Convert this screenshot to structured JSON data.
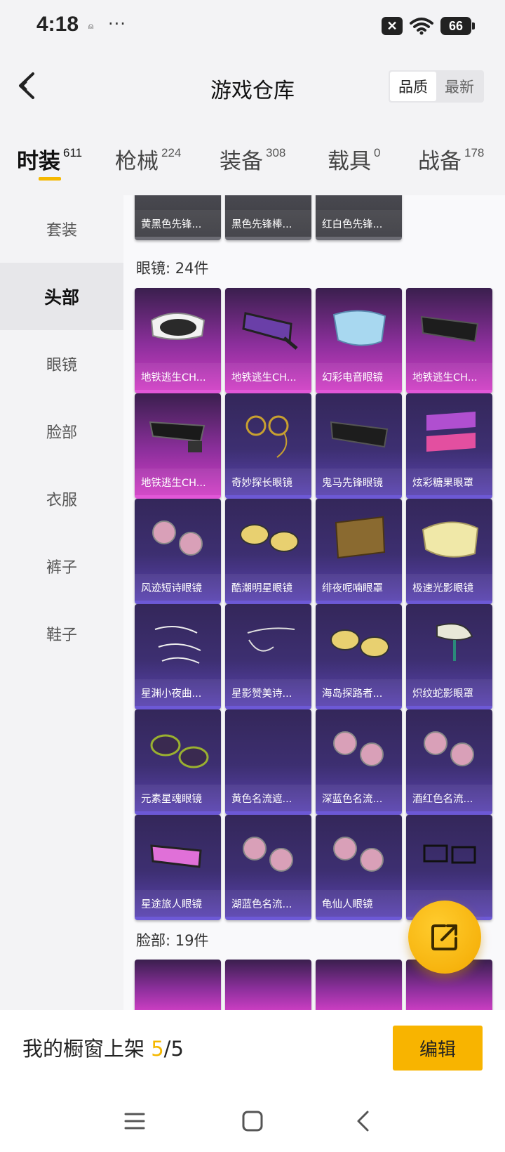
{
  "status_bar": {
    "time": "4:18",
    "small_icon": "⍝",
    "dots": "···",
    "battery": "66"
  },
  "header": {
    "title": "游戏仓库",
    "sort_options": [
      "品质",
      "最新"
    ]
  },
  "tabs": [
    {
      "label": "时装",
      "count": "611"
    },
    {
      "label": "枪械",
      "count": "224"
    },
    {
      "label": "装备",
      "count": "308"
    },
    {
      "label": "载具",
      "count": "0"
    },
    {
      "label": "战备",
      "count": "178"
    }
  ],
  "sidebar": {
    "items": [
      "套装",
      "头部",
      "眼镜",
      "脸部",
      "衣服",
      "裤子",
      "鞋子"
    ],
    "active_index": 1
  },
  "partial_row": [
    "黄黑色先锋...",
    "黑色先锋棒...",
    "红白色先锋..."
  ],
  "glasses_section": {
    "title": "眼镜: 24件",
    "items": [
      {
        "name": "地铁逃生CH...",
        "rarity": "pink",
        "icon": "goggles-icon"
      },
      {
        "name": "地铁逃生CH...",
        "rarity": "pink",
        "icon": "visor-icon"
      },
      {
        "name": "幻彩电音眼镜",
        "rarity": "pink",
        "icon": "shield-visor-icon"
      },
      {
        "name": "地铁逃生CH...",
        "rarity": "pink",
        "icon": "sunglasses-icon"
      },
      {
        "name": "地铁逃生CH...",
        "rarity": "pink",
        "icon": "tactical-glasses-icon"
      },
      {
        "name": "奇妙探长眼镜",
        "rarity": "purple",
        "icon": "monocle-icon"
      },
      {
        "name": "鬼马先锋眼镜",
        "rarity": "purple",
        "icon": "sunglasses-icon"
      },
      {
        "name": "炫彩糖果眼罩",
        "rarity": "purple",
        "icon": "candy-mask-icon"
      },
      {
        "name": "风迹短诗眼镜",
        "rarity": "purple",
        "icon": "round-glasses-icon"
      },
      {
        "name": "酷潮明星眼镜",
        "rarity": "purple",
        "icon": "aviator-icon"
      },
      {
        "name": "绯夜呢喃眼罩",
        "rarity": "purple",
        "icon": "lace-mask-icon"
      },
      {
        "name": "极速光影眼镜",
        "rarity": "purple",
        "icon": "honeycomb-visor-icon"
      },
      {
        "name": "星渊小夜曲...",
        "rarity": "purple",
        "icon": "wire-glasses-icon"
      },
      {
        "name": "星影赞美诗...",
        "rarity": "purple",
        "icon": "half-frame-icon"
      },
      {
        "name": "海岛探路者...",
        "rarity": "purple",
        "icon": "aviator-icon"
      },
      {
        "name": "炽纹蛇影眼罩",
        "rarity": "purple",
        "icon": "snake-mask-icon"
      },
      {
        "name": "元素星魂眼镜",
        "rarity": "purple",
        "icon": "sport-glasses-icon"
      },
      {
        "name": "黄色名流遮...",
        "rarity": "purple",
        "icon": "empty-icon"
      },
      {
        "name": "深蓝色名流...",
        "rarity": "purple",
        "icon": "round-glasses-icon"
      },
      {
        "name": "酒红色名流...",
        "rarity": "purple",
        "icon": "round-glasses-icon"
      },
      {
        "name": "星途旅人眼镜",
        "rarity": "purple",
        "icon": "ski-goggles-icon"
      },
      {
        "name": "湖蓝色名流...",
        "rarity": "purple",
        "icon": "round-glasses-icon"
      },
      {
        "name": "龟仙人眼镜",
        "rarity": "purple",
        "icon": "round-glasses-icon"
      },
      {
        "name": "",
        "rarity": "purple",
        "icon": "rect-glasses-icon"
      }
    ]
  },
  "face_section": {
    "title": "脸部: 19件"
  },
  "bottom_bar": {
    "label": "我的橱窗上架 ",
    "count": "5",
    "total": "/5",
    "edit_label": "编辑"
  },
  "colors": {
    "accent": "#f8b400",
    "purple_card": "#3d2f71",
    "pink_card": "#d03fc5"
  }
}
